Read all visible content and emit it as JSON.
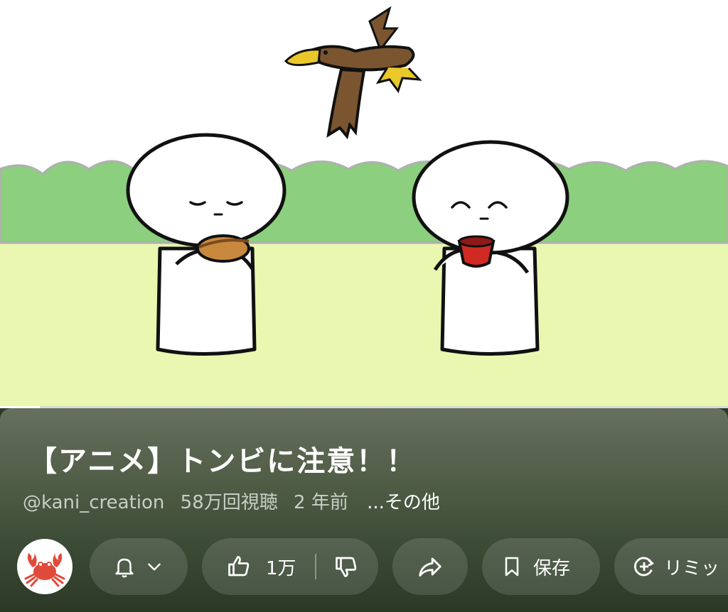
{
  "video": {
    "progress_fraction": 0.055
  },
  "title": "【アニメ】トンビに注意！！",
  "meta": {
    "channel": "@kani_creation",
    "views": "58万回視聴",
    "age": "2 年前",
    "more": "...その他"
  },
  "actions": {
    "like_count": "1万",
    "save_label": "保存",
    "remix_label": "リミッ"
  },
  "icons": {
    "avatar": "crab-icon",
    "bell": "bell-icon",
    "chevron": "chevron-down-icon",
    "like": "thumbs-up-icon",
    "dislike": "thumbs-down-icon",
    "share": "share-arrow-icon",
    "save": "bookmark-icon",
    "remix": "remix-icon"
  },
  "colors": {
    "sky": "#ffffff",
    "hedge": "#8ccf7e",
    "grass": "#e9f7b0",
    "bird": "#7a5530",
    "beak": "#e8c82a",
    "cup": "#d02a22",
    "bun": "#c8893e"
  }
}
